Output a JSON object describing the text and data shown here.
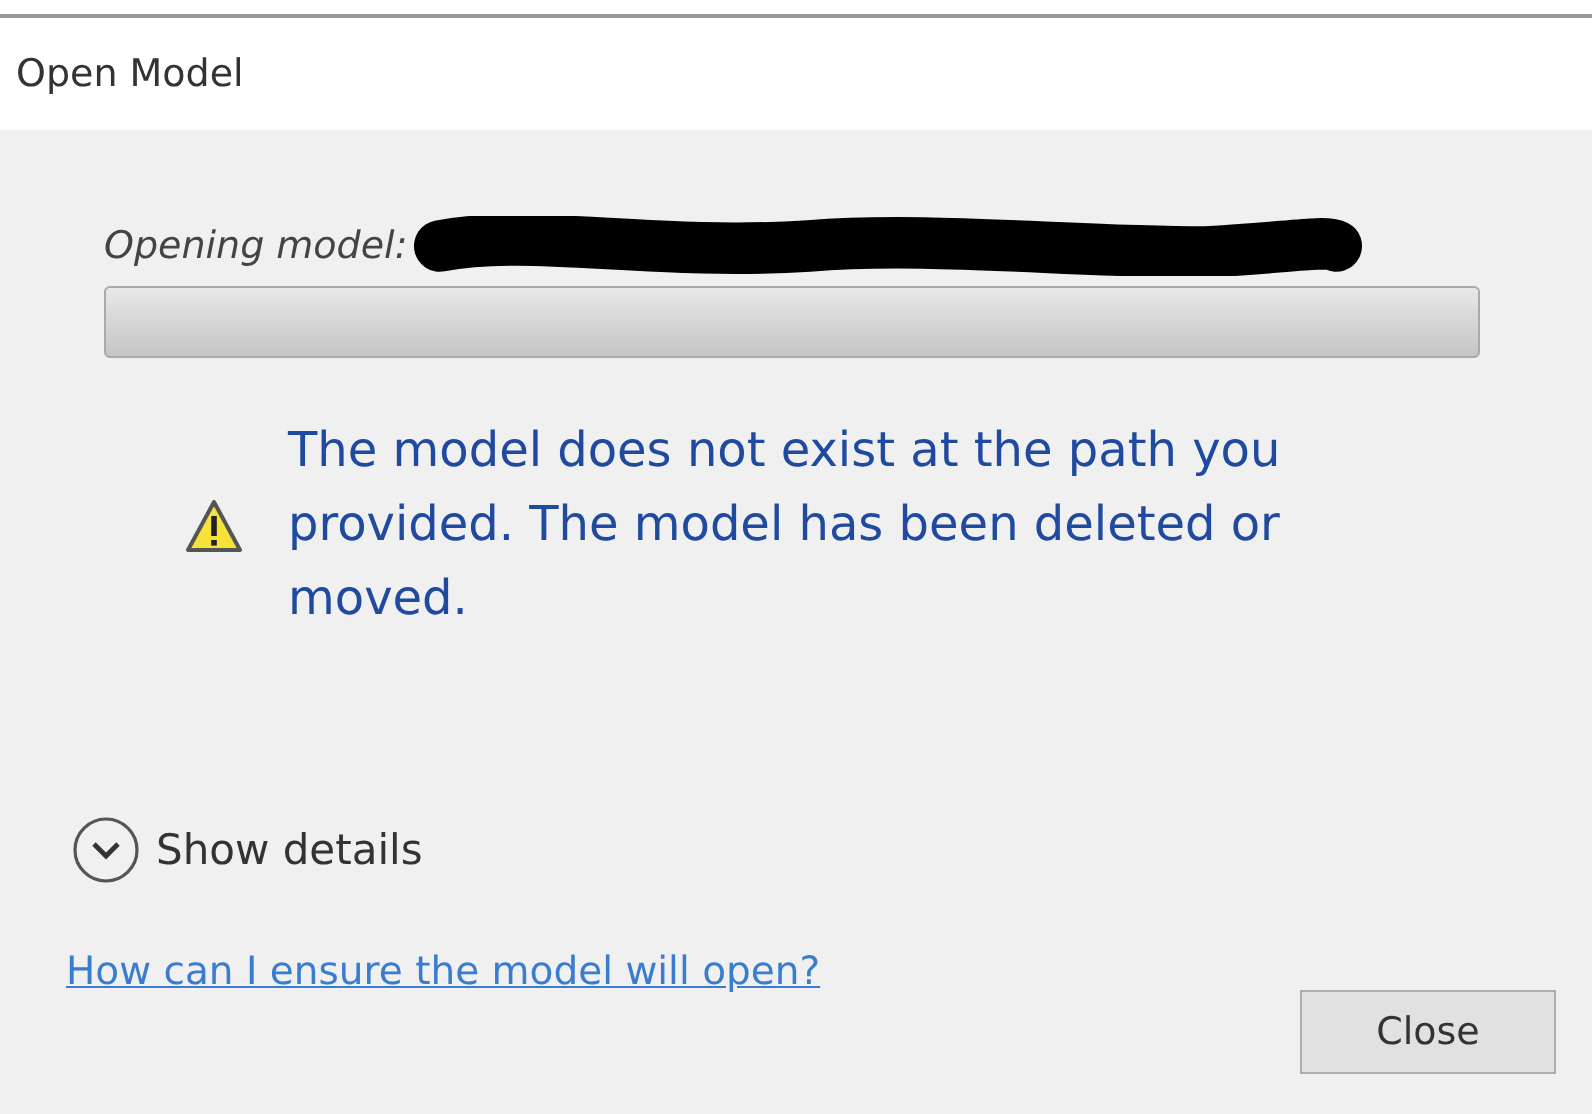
{
  "window": {
    "title": "Open Model"
  },
  "progress": {
    "label": "Opening model:",
    "level": 0
  },
  "message": {
    "text": "The model does not exist at the path you provided.  The model has been deleted or moved."
  },
  "details": {
    "label": "Show details",
    "expanded": false
  },
  "help_link": "How can I ensure the model will open?",
  "buttons": [
    "Close"
  ]
}
